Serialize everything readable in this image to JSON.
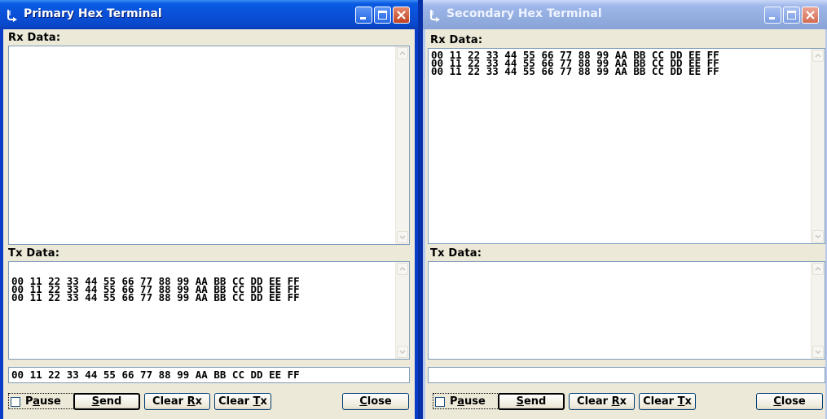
{
  "primary": {
    "title": "Primary Hex Terminal",
    "rx_label": "Rx Data:",
    "rx_lines": [],
    "tx_label": "Tx Data:",
    "tx_lines": [
      "00 11 22 33 44 55 66 77 88 99 AA BB CC DD EE FF",
      "00 11 22 33 44 55 66 77 88 99 AA BB CC DD EE FF",
      "00 11 22 33 44 55 66 77 88 99 AA BB CC DD EE FF"
    ],
    "send_value": "00 11 22 33 44 55 66 77 88 99 AA BB CC DD EE FF",
    "pause_label": "Pause",
    "send_label": "Send",
    "clear_rx_label": "Clear Rx",
    "clear_tx_label": "Clear Tx",
    "close_label": "Close",
    "active": true
  },
  "secondary": {
    "title": "Secondary Hex Terminal",
    "rx_label": "Rx Data:",
    "rx_lines": [
      "00 11 22 33 44 55 66 77 88 99 AA BB CC DD EE FF",
      "00 11 22 33 44 55 66 77 88 99 AA BB CC DD EE FF",
      "00 11 22 33 44 55 66 77 88 99 AA BB CC DD EE FF"
    ],
    "tx_label": "Tx Data:",
    "tx_lines": [],
    "send_value": "",
    "pause_label": "Pause",
    "send_label": "Send",
    "clear_rx_label": "Clear Rx",
    "clear_tx_label": "Clear Tx",
    "close_label": "Close",
    "active": false
  },
  "colors": {
    "active_titlebar": "#0a50d8",
    "inactive_titlebar": "#93addf",
    "client_bg": "#ece9d8",
    "close_button": "#c1401f"
  },
  "icons": [
    "terminal-app-icon",
    "minimize-icon",
    "maximize-icon",
    "close-icon",
    "scroll-up-arrow-icon",
    "scroll-down-arrow-icon"
  ]
}
